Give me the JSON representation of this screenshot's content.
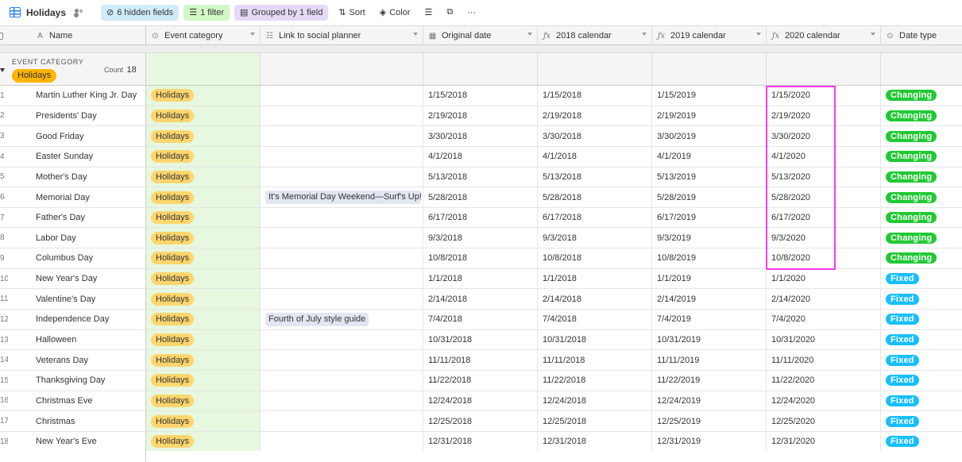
{
  "toolbar": {
    "title": "Holidays",
    "hidden_fields": "6 hidden fields",
    "filter": "1 filter",
    "grouped": "Grouped by 1 field",
    "sort": "Sort",
    "color": "Color",
    "more": "···"
  },
  "columns": {
    "name": "Name",
    "event_category": "Event category",
    "link_social": "Link to social planner",
    "original_date": "Original date",
    "cal2018": "2018 calendar",
    "cal2019": "2019 calendar",
    "cal2020": "2020 calendar",
    "date_type": "Date type"
  },
  "group": {
    "label": "EVENT CATEGORY",
    "value": "Holidays",
    "count_label": "Count",
    "count": "18"
  },
  "colors": {
    "changing": "#20c933",
    "fixed": "#18bfff",
    "highlight": "#f53cf0"
  },
  "rows": [
    {
      "num": "1",
      "name": "Martin Luther King Jr. Day",
      "category": "Holidays",
      "link": "",
      "original": "1/15/2018",
      "c2018": "1/15/2018",
      "c2019": "1/15/2019",
      "c2020": "1/15/2020",
      "type": "Changing"
    },
    {
      "num": "2",
      "name": "Presidents' Day",
      "category": "Holidays",
      "link": "",
      "original": "2/19/2018",
      "c2018": "2/19/2018",
      "c2019": "2/19/2019",
      "c2020": "2/19/2020",
      "type": "Changing"
    },
    {
      "num": "3",
      "name": "Good Friday",
      "category": "Holidays",
      "link": "",
      "original": "3/30/2018",
      "c2018": "3/30/2018",
      "c2019": "3/30/2019",
      "c2020": "3/30/2020",
      "type": "Changing"
    },
    {
      "num": "4",
      "name": "Easter Sunday",
      "category": "Holidays",
      "link": "",
      "original": "4/1/2018",
      "c2018": "4/1/2018",
      "c2019": "4/1/2019",
      "c2020": "4/1/2020",
      "type": "Changing"
    },
    {
      "num": "5",
      "name": "Mother's Day",
      "category": "Holidays",
      "link": "",
      "original": "5/13/2018",
      "c2018": "5/13/2018",
      "c2019": "5/13/2019",
      "c2020": "5/13/2020",
      "type": "Changing"
    },
    {
      "num": "6",
      "name": "Memorial Day",
      "category": "Holidays",
      "link": "It's Memorial Day Weekend—Surf's Up!",
      "original": "5/28/2018",
      "c2018": "5/28/2018",
      "c2019": "5/28/2019",
      "c2020": "5/28/2020",
      "type": "Changing"
    },
    {
      "num": "7",
      "name": "Father's Day",
      "category": "Holidays",
      "link": "",
      "original": "6/17/2018",
      "c2018": "6/17/2018",
      "c2019": "6/17/2019",
      "c2020": "6/17/2020",
      "type": "Changing"
    },
    {
      "num": "8",
      "name": "Labor Day",
      "category": "Holidays",
      "link": "",
      "original": "9/3/2018",
      "c2018": "9/3/2018",
      "c2019": "9/3/2019",
      "c2020": "9/3/2020",
      "type": "Changing"
    },
    {
      "num": "9",
      "name": "Columbus Day",
      "category": "Holidays",
      "link": "",
      "original": "10/8/2018",
      "c2018": "10/8/2018",
      "c2019": "10/8/2019",
      "c2020": "10/8/2020",
      "type": "Changing"
    },
    {
      "num": "10",
      "name": "New Year's Day",
      "category": "Holidays",
      "link": "",
      "original": "1/1/2018",
      "c2018": "1/1/2018",
      "c2019": "1/1/2019",
      "c2020": "1/1/2020",
      "type": "Fixed"
    },
    {
      "num": "11",
      "name": "Valentine's Day",
      "category": "Holidays",
      "link": "",
      "original": "2/14/2018",
      "c2018": "2/14/2018",
      "c2019": "2/14/2019",
      "c2020": "2/14/2020",
      "type": "Fixed"
    },
    {
      "num": "12",
      "name": "Independence Day",
      "category": "Holidays",
      "link": "Fourth of July style guide",
      "original": "7/4/2018",
      "c2018": "7/4/2018",
      "c2019": "7/4/2019",
      "c2020": "7/4/2020",
      "type": "Fixed"
    },
    {
      "num": "13",
      "name": "Halloween",
      "category": "Holidays",
      "link": "",
      "original": "10/31/2018",
      "c2018": "10/31/2018",
      "c2019": "10/31/2019",
      "c2020": "10/31/2020",
      "type": "Fixed"
    },
    {
      "num": "14",
      "name": "Veterans Day",
      "category": "Holidays",
      "link": "",
      "original": "11/11/2018",
      "c2018": "11/11/2018",
      "c2019": "11/11/2019",
      "c2020": "11/11/2020",
      "type": "Fixed"
    },
    {
      "num": "15",
      "name": "Thanksgiving Day",
      "category": "Holidays",
      "link": "",
      "original": "11/22/2018",
      "c2018": "11/22/2018",
      "c2019": "11/22/2019",
      "c2020": "11/22/2020",
      "type": "Fixed"
    },
    {
      "num": "16",
      "name": "Christmas Eve",
      "category": "Holidays",
      "link": "",
      "original": "12/24/2018",
      "c2018": "12/24/2018",
      "c2019": "12/24/2019",
      "c2020": "12/24/2020",
      "type": "Fixed"
    },
    {
      "num": "17",
      "name": "Christmas",
      "category": "Holidays",
      "link": "",
      "original": "12/25/2018",
      "c2018": "12/25/2018",
      "c2019": "12/25/2019",
      "c2020": "12/25/2020",
      "type": "Fixed"
    },
    {
      "num": "18",
      "name": "New Year's Eve",
      "category": "Holidays",
      "link": "",
      "original": "12/31/2018",
      "c2018": "12/31/2018",
      "c2019": "12/31/2019",
      "c2020": "12/31/2020",
      "type": "Fixed"
    }
  ]
}
